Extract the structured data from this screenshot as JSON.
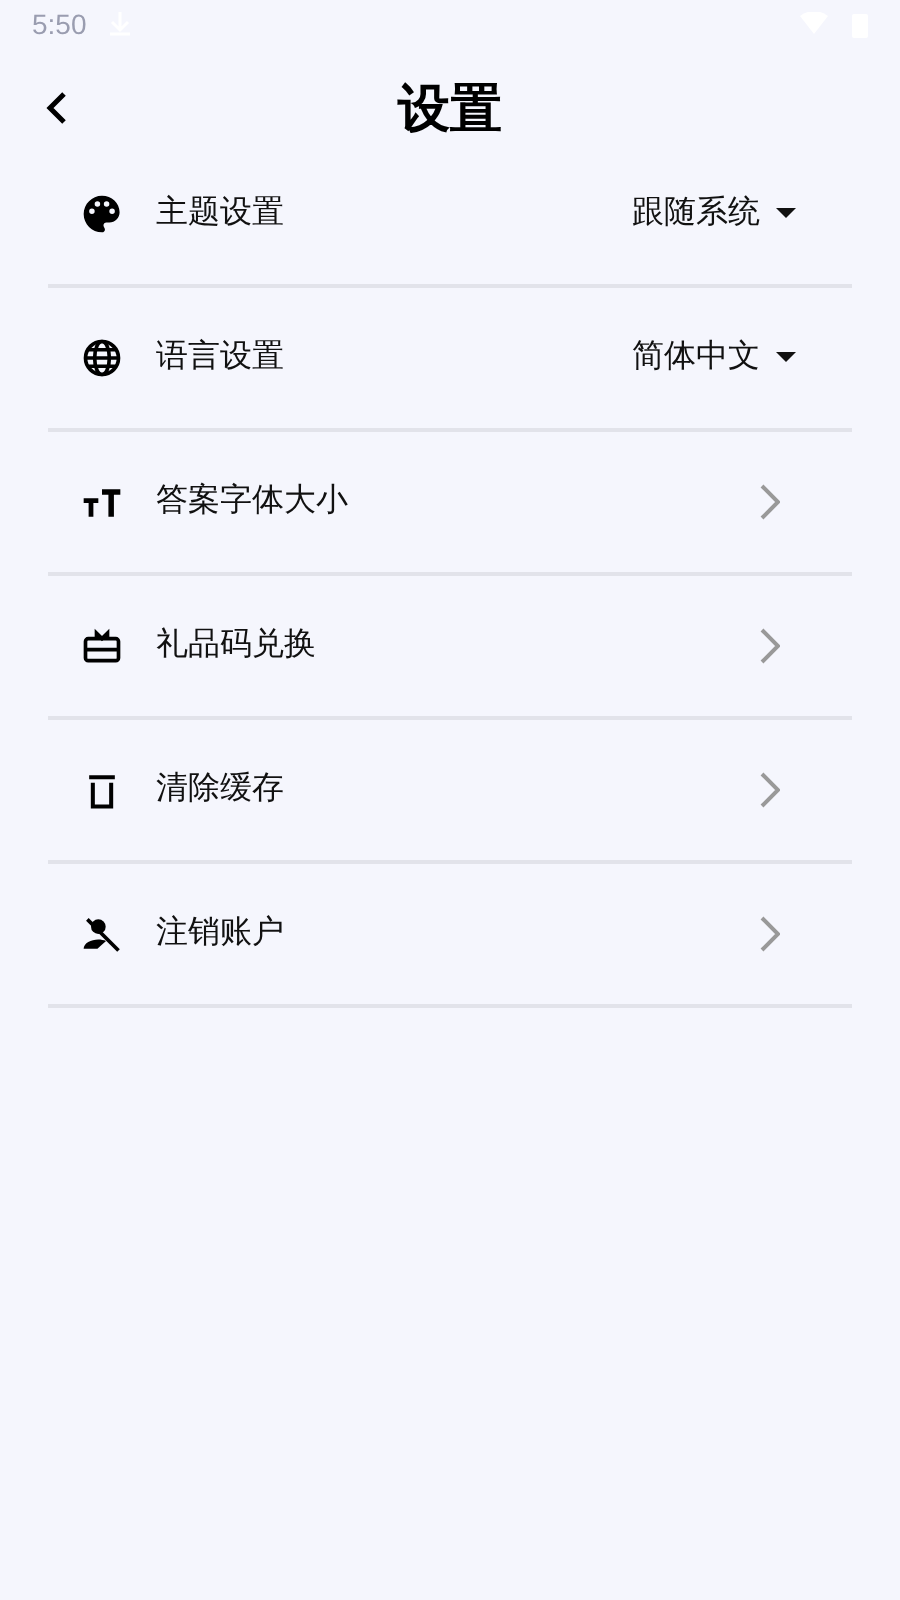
{
  "status_bar": {
    "time": "5:50"
  },
  "header": {
    "title": "设置"
  },
  "items": [
    {
      "label": "主题设置",
      "kind": "dropdown",
      "value": "跟随系统"
    },
    {
      "label": "语言设置",
      "kind": "dropdown",
      "value": "简体中文"
    },
    {
      "label": "答案字体大小",
      "kind": "link"
    },
    {
      "label": "礼品码兑换",
      "kind": "link"
    },
    {
      "label": "清除缓存",
      "kind": "link"
    },
    {
      "label": "注销账户",
      "kind": "link"
    }
  ]
}
